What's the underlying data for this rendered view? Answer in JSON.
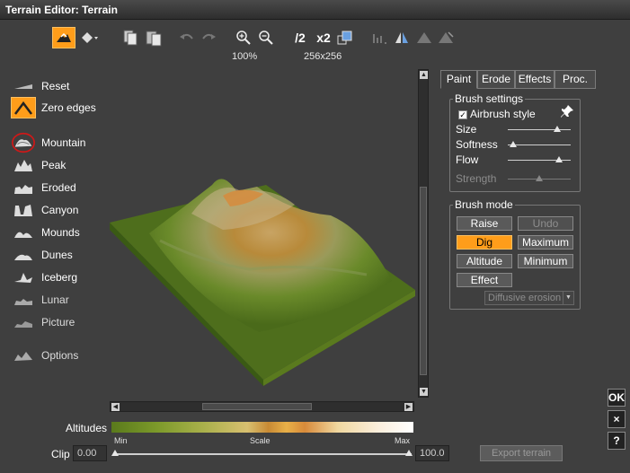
{
  "window": {
    "title": "Terrain Editor: Terrain"
  },
  "toolbar": {
    "zoom_value": "100%",
    "resolution_value": "256x256",
    "half_label": "/2",
    "double_label": "x2"
  },
  "brushes": [
    {
      "label": "Reset",
      "icon": "reset-icon"
    },
    {
      "label": "Zero edges",
      "icon": "zero-edges-icon"
    },
    {
      "label": "Mountain",
      "icon": "mountain-icon"
    },
    {
      "label": "Peak",
      "icon": "peak-icon"
    },
    {
      "label": "Eroded",
      "icon": "eroded-icon"
    },
    {
      "label": "Canyon",
      "icon": "canyon-icon"
    },
    {
      "label": "Mounds",
      "icon": "mounds-icon"
    },
    {
      "label": "Dunes",
      "icon": "dunes-icon"
    },
    {
      "label": "Iceberg",
      "icon": "iceberg-icon"
    },
    {
      "label": "Lunar",
      "icon": "lunar-icon"
    },
    {
      "label": "Picture",
      "icon": "picture-icon"
    },
    {
      "label": "Options",
      "icon": "options-icon"
    }
  ],
  "altitudes": {
    "label": "Altitudes",
    "min_label": "Min",
    "scale_label": "Scale",
    "max_label": "Max"
  },
  "clip": {
    "label": "Clip",
    "min_value": "0.00",
    "max_value": "100.0"
  },
  "export_label": "Export terrain",
  "tabs": [
    {
      "label": "Paint",
      "active": true
    },
    {
      "label": "Erode",
      "active": false
    },
    {
      "label": "Effects",
      "active": false
    },
    {
      "label": "Proc.",
      "active": false
    }
  ],
  "brush_settings": {
    "title": "Brush settings",
    "airbrush_label": "Airbrush style",
    "airbrush_checked": true,
    "sliders": [
      {
        "label": "Size",
        "value": 0.78,
        "enabled": true
      },
      {
        "label": "Softness",
        "value": 0.08,
        "enabled": true
      },
      {
        "label": "Flow",
        "value": 0.82,
        "enabled": true
      },
      {
        "label": "Strength",
        "value": 0.5,
        "enabled": false
      }
    ]
  },
  "brush_mode": {
    "title": "Brush mode",
    "raise_label": "Raise",
    "undo_label": "Undo",
    "dig_label": "Dig",
    "maximum_label": "Maximum",
    "altitude_label": "Altitude",
    "minimum_label": "Minimum",
    "effect_label": "Effect",
    "effect_select_value": "Diffusive erosion"
  },
  "side_buttons": {
    "ok_label": "OK",
    "close_label": "×",
    "help_label": "?"
  },
  "colors": {
    "accent": "#ff9d1a",
    "background": "#3f3f3f"
  }
}
